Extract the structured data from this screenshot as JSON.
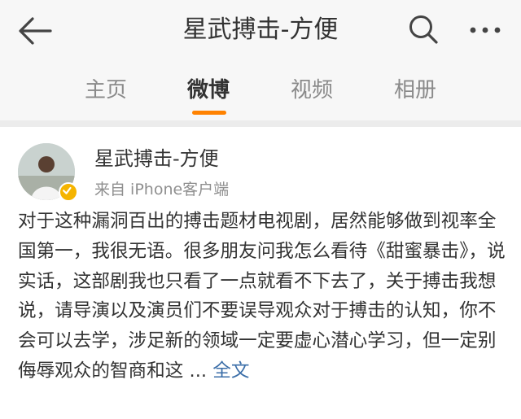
{
  "header": {
    "title": "星武搏击-方便"
  },
  "tabs": [
    {
      "label": "主页",
      "active": false
    },
    {
      "label": "微博",
      "active": true
    },
    {
      "label": "视频",
      "active": false
    },
    {
      "label": "相册",
      "active": false
    }
  ],
  "post": {
    "author": "星武搏击-方便",
    "source": "来自 iPhone客户端",
    "text": "对于这种漏洞百出的搏击题材电视剧，居然能够做到视率全国第一，我很无语。很多朋友问我怎么看待《甜蜜暴击》，说实话，这部剧我也只看了一点就看不下去了，关于搏击我想说，请导演以及演员们不要误导观众对于搏击的认知，你不会可以去学，涉足新的领域一定要虚心潜心学习，但一定别侮辱观众的智商和这 ...",
    "more_label": "全文"
  },
  "colors": {
    "accent": "#ff8200",
    "link": "#3b6ea8",
    "verified": "#f5b400"
  },
  "icons": [
    "back-arrow-icon",
    "search-icon",
    "more-icon",
    "verified-icon"
  ]
}
